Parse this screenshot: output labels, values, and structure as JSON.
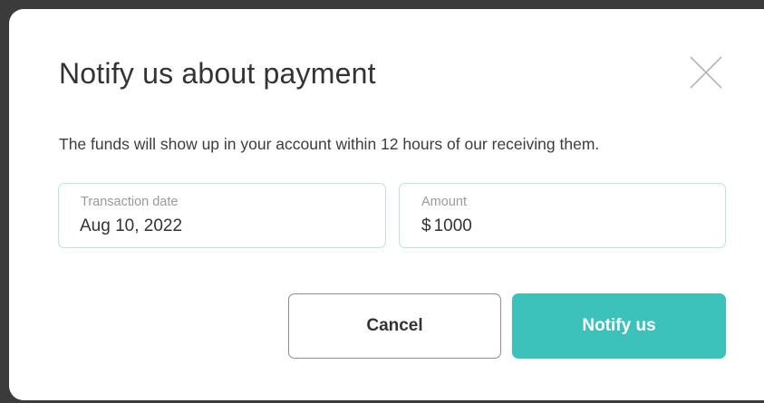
{
  "dialog": {
    "title": "Notify us about payment",
    "description": "The funds will show up in your account within 12 hours of our receiving them.",
    "close_icon": "close-icon"
  },
  "form": {
    "transaction_date": {
      "label": "Transaction date",
      "value": "Aug 10, 2022"
    },
    "amount": {
      "label": "Amount",
      "currency": "$",
      "value": "1000"
    }
  },
  "actions": {
    "cancel_label": "Cancel",
    "notify_label": "Notify us"
  },
  "colors": {
    "accent": "#3cc2bb",
    "field_border": "#bfe3e0",
    "backdrop": "#3b3b3b"
  }
}
